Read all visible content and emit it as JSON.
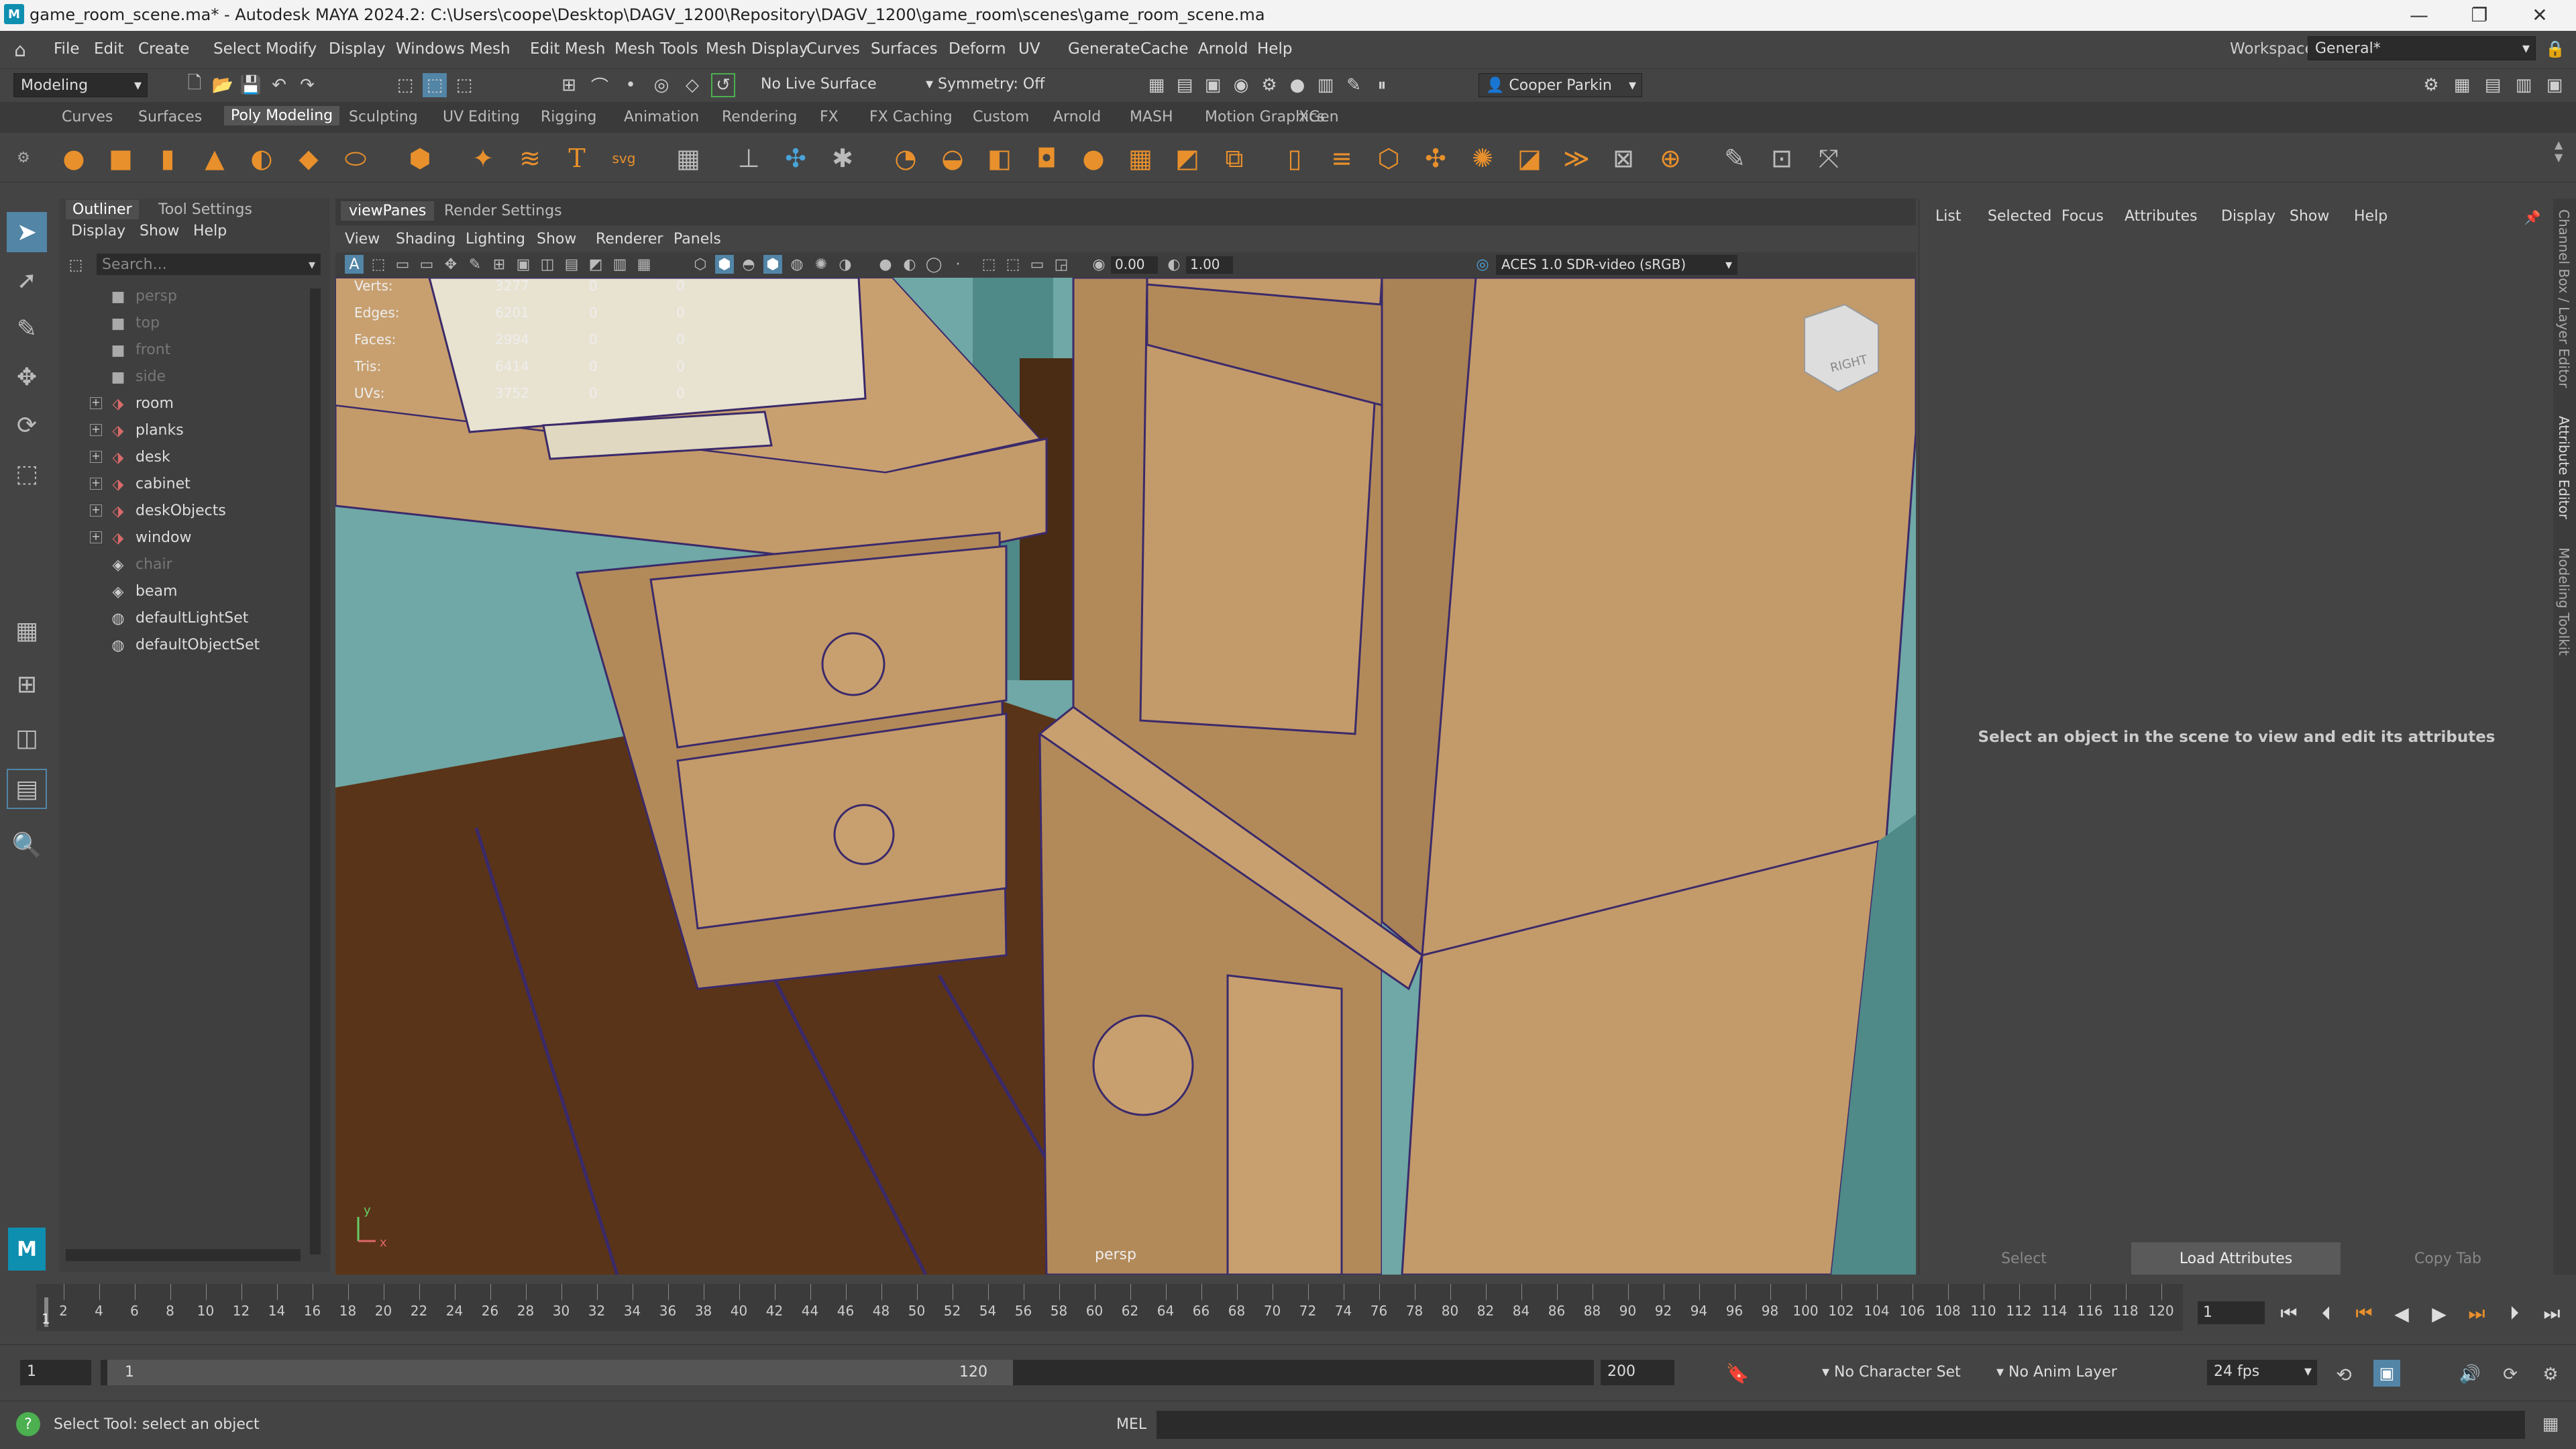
{
  "title_bar": {
    "title": "game_room_scene.ma* - Autodesk MAYA 2024.2: C:\\Users\\coope\\Desktop\\DAGV_1200\\Repository\\DAGV_1200\\game_room\\scenes\\game_room_scene.ma",
    "logo": "M"
  },
  "menu": [
    "File",
    "Edit",
    "Create",
    "Select",
    "Modify",
    "Display",
    "Windows",
    "Mesh",
    "Edit Mesh",
    "Mesh Tools",
    "Mesh Display",
    "Curves",
    "Surfaces",
    "Deform",
    "UV",
    "Generate",
    "Cache",
    "Arnold",
    "Help"
  ],
  "workspace": {
    "label": "Workspace:",
    "value": "General*"
  },
  "status": {
    "mode": "Modeling",
    "live_surface": "No Live Surface",
    "symmetry": "Symmetry: Off",
    "user": "Cooper Parkin"
  },
  "shelf_tabs": [
    "Curves",
    "Surfaces",
    "Poly Modeling",
    "Sculpting",
    "UV Editing",
    "Rigging",
    "Animation",
    "Rendering",
    "FX",
    "FX Caching",
    "Custom",
    "Arnold",
    "MASH",
    "Motion Graphics",
    "XGen"
  ],
  "shelf_active": "Poly Modeling",
  "outliner": {
    "tabs": [
      "Outliner",
      "Tool Settings"
    ],
    "menu": [
      "Display",
      "Show",
      "Help"
    ],
    "search_placeholder": "Search...",
    "items": [
      {
        "label": "persp",
        "icon": "camera-icon",
        "dim": true,
        "expand": false
      },
      {
        "label": "top",
        "icon": "camera-icon",
        "dim": true,
        "expand": false
      },
      {
        "label": "front",
        "icon": "camera-icon",
        "dim": true,
        "expand": false
      },
      {
        "label": "side",
        "icon": "camera-icon",
        "dim": true,
        "expand": false
      },
      {
        "label": "room",
        "icon": "group-icon",
        "dim": false,
        "expand": true
      },
      {
        "label": "planks",
        "icon": "group-icon",
        "dim": false,
        "expand": true
      },
      {
        "label": "desk",
        "icon": "group-icon",
        "dim": false,
        "expand": true
      },
      {
        "label": "cabinet",
        "icon": "group-icon",
        "dim": false,
        "expand": true
      },
      {
        "label": "deskObjects",
        "icon": "group-icon",
        "dim": false,
        "expand": true
      },
      {
        "label": "window",
        "icon": "group-icon",
        "dim": false,
        "expand": true
      },
      {
        "label": "chair",
        "icon": "mesh-icon",
        "dim": true,
        "expand": false
      },
      {
        "label": "beam",
        "icon": "mesh-icon",
        "dim": false,
        "expand": false
      },
      {
        "label": "defaultLightSet",
        "icon": "set-icon",
        "dim": false,
        "expand": false
      },
      {
        "label": "defaultObjectSet",
        "icon": "set-icon",
        "dim": false,
        "expand": false
      }
    ]
  },
  "viewport": {
    "tabs": [
      "viewPanes",
      "Render Settings"
    ],
    "menu": [
      "View",
      "Shading",
      "Lighting",
      "Show",
      "Renderer",
      "Panels"
    ],
    "exposure": "0.00",
    "gamma": "1.00",
    "color_space": "ACES 1.0 SDR-video (sRGB)",
    "camera_label": "persp",
    "view_cube": "RIGHT",
    "hud": [
      {
        "label": "Verts:",
        "a": "3277",
        "b": "0",
        "c": "0"
      },
      {
        "label": "Edges:",
        "a": "6201",
        "b": "0",
        "c": "0"
      },
      {
        "label": "Faces:",
        "a": "2994",
        "b": "0",
        "c": "0"
      },
      {
        "label": "Tris:",
        "a": "6414",
        "b": "0",
        "c": "0"
      },
      {
        "label": "UVs:",
        "a": "3752",
        "b": "0",
        "c": "0"
      }
    ],
    "axis": {
      "y": "y",
      "x": "x"
    },
    "colors": {
      "wall": "#6fa8a6",
      "wood": "#c39a6a",
      "floor": "#5a3418",
      "edge": "#3b2a6a"
    }
  },
  "attribute_editor": {
    "menu": [
      "List",
      "Selected",
      "Focus",
      "Attributes",
      "Display",
      "Show",
      "Help"
    ],
    "message": "Select an object in the scene to view and edit its attributes",
    "buttons": [
      "Select",
      "Load Attributes",
      "Copy Tab"
    ]
  },
  "side_tabs": [
    "Channel Box / Layer Editor",
    "Attribute Editor",
    "Modeling Toolkit"
  ],
  "timeline": {
    "ticks": [
      2,
      4,
      6,
      8,
      10,
      12,
      14,
      16,
      18,
      20,
      22,
      24,
      26,
      28,
      30,
      32,
      34,
      36,
      38,
      40,
      42,
      44,
      46,
      48,
      50,
      52,
      54,
      56,
      58,
      60,
      62,
      64,
      66,
      68,
      70,
      72,
      74,
      76,
      78,
      80,
      82,
      84,
      86,
      88,
      90,
      92,
      94,
      96,
      98,
      100,
      102,
      104,
      106,
      108,
      110,
      112,
      114,
      116,
      118,
      120
    ],
    "current_marker": "1",
    "current_frame": "1"
  },
  "range": {
    "start": "1",
    "inner_start": "1",
    "inner_end": "120",
    "end": "200",
    "character_set": "No Character Set",
    "anim_layer": "No Anim Layer",
    "fps": "24 fps"
  },
  "command_line": {
    "help": "Select Tool: select an object",
    "lang": "MEL"
  }
}
